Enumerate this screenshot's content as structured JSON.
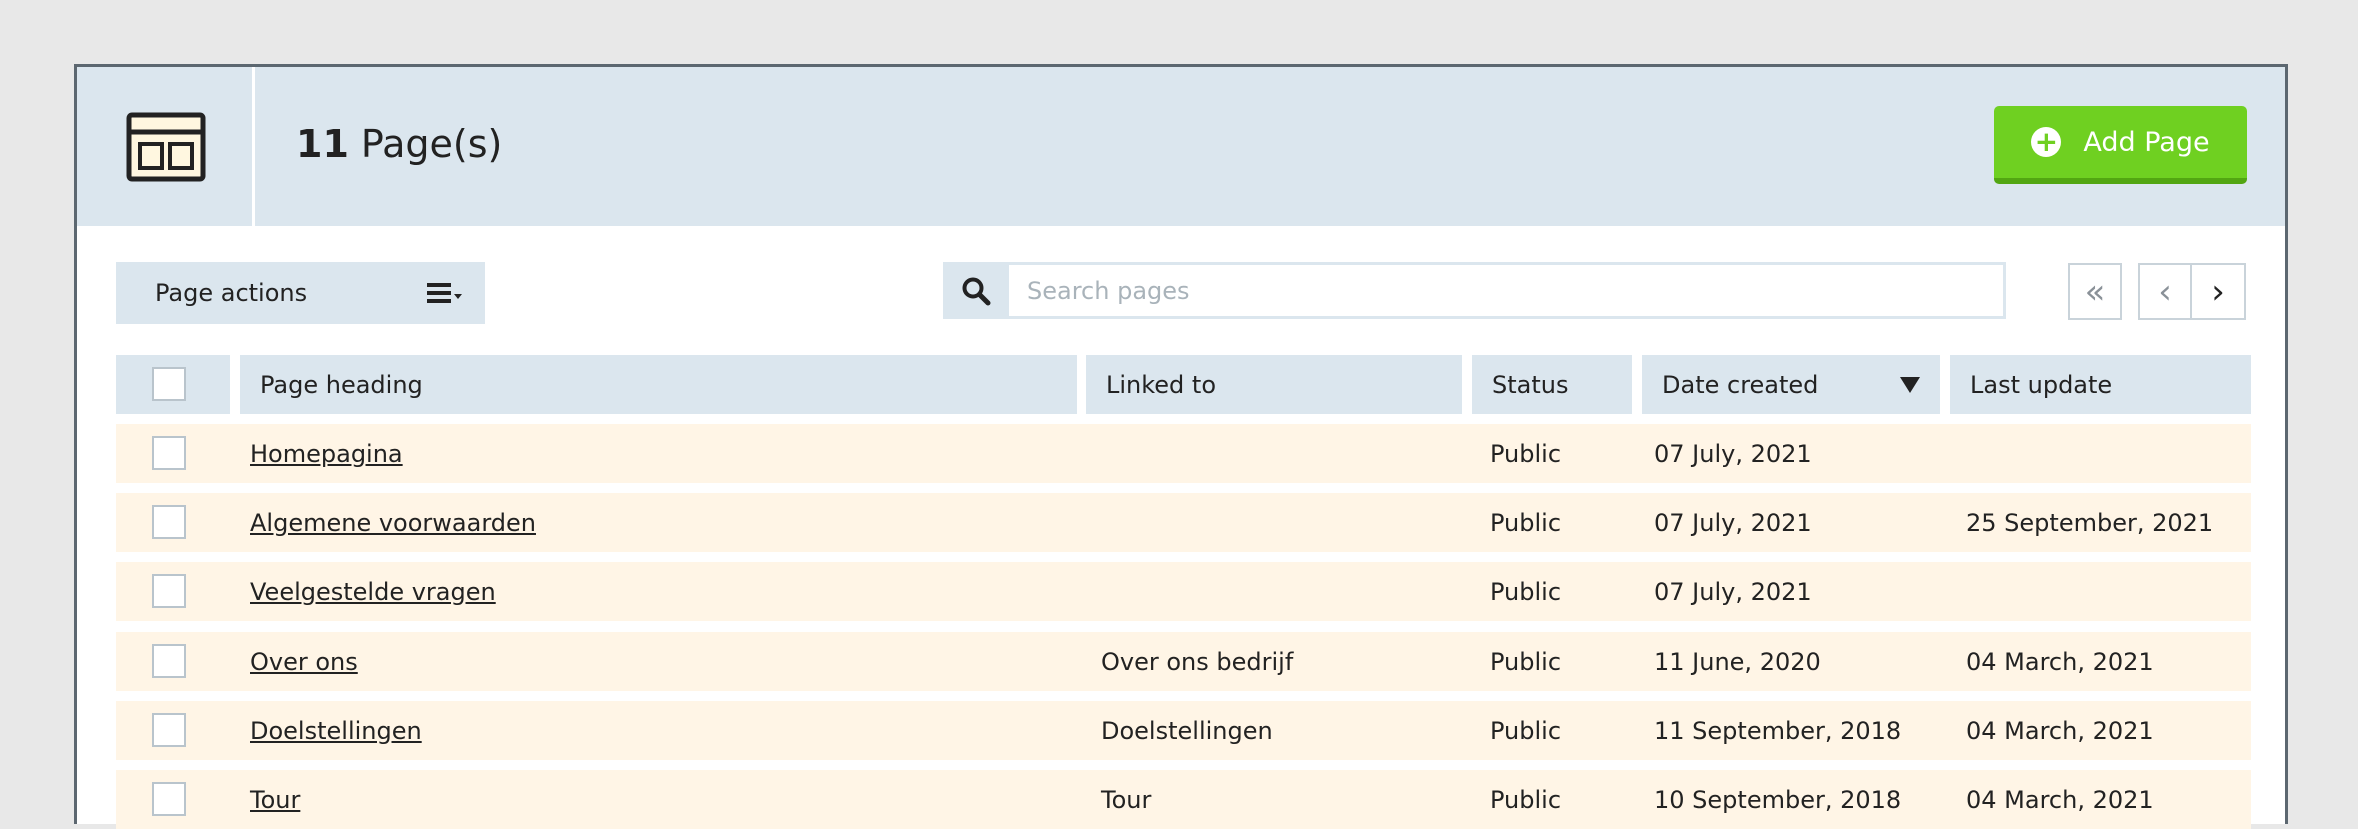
{
  "header": {
    "count": "11",
    "title": "Page(s)",
    "icon": "layout-icon",
    "add_button": "Add Page"
  },
  "toolbar": {
    "actions_label": "Page actions",
    "search_placeholder": "Search pages",
    "pager": {
      "first": "«",
      "prev": "‹",
      "next": "›"
    }
  },
  "table": {
    "columns": [
      "Page heading",
      "Linked to",
      "Status",
      "Date created",
      "Last update"
    ],
    "sorted_column": "Date created",
    "rows": [
      {
        "heading": "Homepagina",
        "linked": "",
        "status": "Public",
        "created": "07 July, 2021",
        "updated": ""
      },
      {
        "heading": "Algemene voorwaarden",
        "linked": "",
        "status": "Public",
        "created": "07 July, 2021",
        "updated": "25 September, 2021"
      },
      {
        "heading": "Veelgestelde vragen",
        "linked": "",
        "status": "Public",
        "created": "07 July, 2021",
        "updated": ""
      },
      {
        "heading": "Over ons",
        "linked": "Over ons bedrijf",
        "status": "Public",
        "created": "11 June, 2020",
        "updated": "04 March, 2021"
      },
      {
        "heading": "Doelstellingen",
        "linked": "Doelstellingen",
        "status": "Public",
        "created": "11 September, 2018",
        "updated": "04 March, 2021"
      },
      {
        "heading": "Tour",
        "linked": "Tour",
        "status": "Public",
        "created": "10 September, 2018",
        "updated": "04 March, 2021"
      }
    ]
  },
  "colors": {
    "accent_green": "#6fd021",
    "header_blue": "#dbe6ee",
    "row_cream": "#fff5e6"
  }
}
